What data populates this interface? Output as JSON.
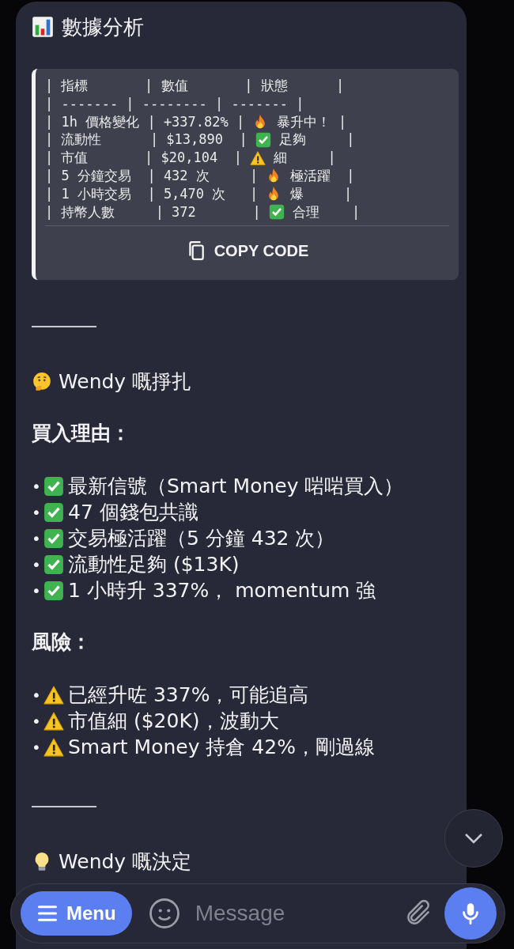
{
  "title": {
    "kind": "chart",
    "text": "數據分析"
  },
  "code_block": {
    "lines": [
      {
        "kind": "plain",
        "before": "| 指標       | 數值       | 狀態      |"
      },
      {
        "kind": "plain",
        "before": "| ------- | -------- | ------- |"
      },
      {
        "kind": "fire",
        "before": "| 1h 價格變化 | +337.82% | ",
        "after": " 暴升中！ |"
      },
      {
        "kind": "check",
        "before": "| 流動性      | $13,890  | ",
        "after": " 足夠     |"
      },
      {
        "kind": "warning",
        "before": "| 市值       | $20,104  | ",
        "after": " 細     |"
      },
      {
        "kind": "fire",
        "before": "| 5 分鐘交易  | 432 次     | ",
        "after": " 極活躍  |"
      },
      {
        "kind": "fire",
        "before": "| 1 小時交易  | 5,470 次   | ",
        "after": " 爆     |"
      },
      {
        "kind": "check",
        "before": "| 持幣人數     | 372       | ",
        "after": " 合理    |"
      }
    ],
    "copy_label": "COPY CODE"
  },
  "sections": [
    {
      "kind": "divider"
    },
    {
      "kind": "thinking_heading",
      "text": "Wendy 嘅掙扎"
    },
    {
      "kind": "bold",
      "text": "買入理由："
    },
    {
      "kind": "bullets",
      "items": [
        {
          "kind": "check",
          "marker": "•",
          "text": "最新信號（Smart Money 啱啱買入）"
        },
        {
          "kind": "check",
          "marker": "•",
          "text": "47 個錢包共識"
        },
        {
          "kind": "check",
          "marker": "•",
          "text": "交易極活躍（5 分鐘 432 次）"
        },
        {
          "kind": "check",
          "marker": "•",
          "text": "流動性足夠 ($13K)"
        },
        {
          "kind": "check",
          "marker": "•",
          "text": "1 小時升 337%， momentum 強"
        }
      ]
    },
    {
      "kind": "bold",
      "text": "風險："
    },
    {
      "kind": "bullets",
      "items": [
        {
          "kind": "warning",
          "marker": "•",
          "text": "已經升咗 337%，可能追高"
        },
        {
          "kind": "warning",
          "marker": "•",
          "text": "市值細 ($20K)，波動大"
        },
        {
          "kind": "warning",
          "marker": "•",
          "text": "Smart Money 持倉 42%，剛過線"
        }
      ]
    },
    {
      "kind": "divider"
    },
    {
      "kind": "bulb_heading",
      "text": "Wendy 嘅決定"
    }
  ],
  "composer": {
    "menu_label": "Menu",
    "placeholder": "Message"
  }
}
